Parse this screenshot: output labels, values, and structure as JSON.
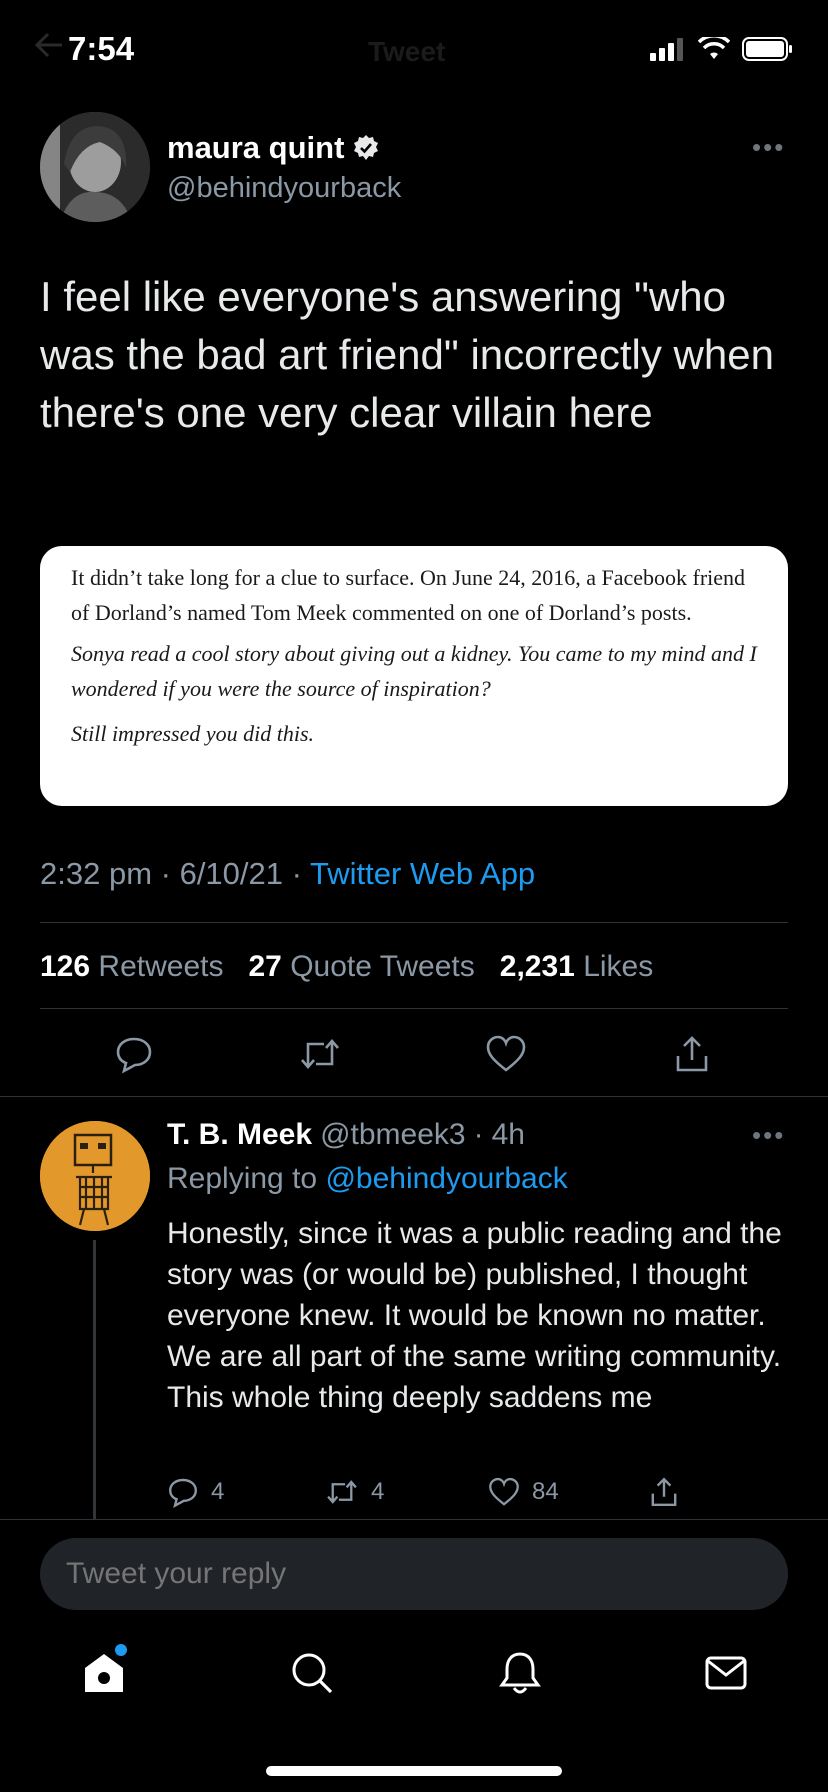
{
  "status_bar": {
    "time": "7:54"
  },
  "nav": {
    "title": "Tweet",
    "back_icon": "arrow-left-icon"
  },
  "tweet": {
    "author_name": "maura quint",
    "author_handle": "@behindyourback",
    "verified": true,
    "text": "I feel like everyone's answering \"who was the bad art friend\" incorrectly when there's one very clear villain here",
    "quote_image": {
      "para1": "It didn’t take long for a clue to surface. On June 24, 2016, a Facebook friend of Dorland’s named Tom Meek commented on one of Dorland’s posts.",
      "para2": "Sonya read a cool story about giving out a kidney. You came to my mind and I wondered if you were the source of inspiration?",
      "para3": "Still impressed you did this."
    },
    "time": "2:32 pm",
    "date": "6/10/21",
    "source_app": "Twitter Web App",
    "stats": {
      "retweets_count": "126",
      "retweets_label": "Retweets",
      "quotes_count": "27",
      "quotes_label": "Quote Tweets",
      "likes_count": "2,231",
      "likes_label": "Likes"
    }
  },
  "reply": {
    "author_name": "T. B. Meek",
    "author_handle": "@tbmeek3",
    "age": "4h",
    "replying_label": "Replying to",
    "replying_to": "@behindyourback",
    "text": "Honestly, since it was a public reading  and the story was (or would be) published, I thought everyone knew. It would be known no matter. We are all part of the same writing community. This whole thing deeply saddens me",
    "replies": "4",
    "retweets": "4",
    "likes": "84"
  },
  "compose": {
    "placeholder": "Tweet your reply"
  },
  "colors": {
    "accent": "#1d9bf0",
    "background": "#000000",
    "muted": "#8b98a5"
  }
}
